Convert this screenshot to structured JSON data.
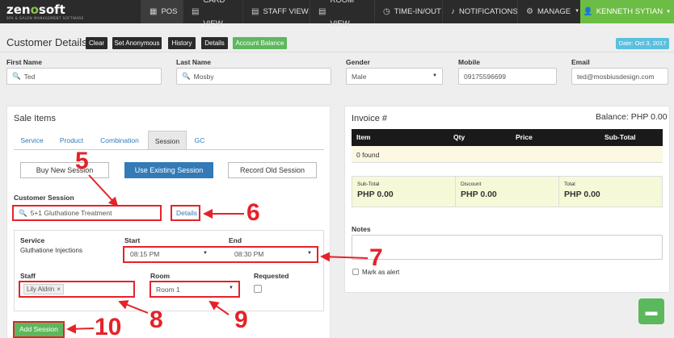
{
  "nav": {
    "logo_main_a": "zen",
    "logo_main_o": "o",
    "logo_main_b": "soft",
    "logo_sub": "SPA & SALON MANAGEMENT SOFTWARE",
    "items": [
      {
        "label": "POS",
        "icon": "grid-icon"
      },
      {
        "label": "CARD VIEW",
        "icon": "cards-icon"
      },
      {
        "label": "STAFF VIEW",
        "icon": "staff-icon"
      },
      {
        "label": "ROOM VIEW",
        "icon": "room-icon"
      },
      {
        "label": "TIME-IN/OUT",
        "icon": "clock-icon"
      },
      {
        "label": "NOTIFICATIONS",
        "icon": "bell-icon"
      },
      {
        "label": "MANAGE",
        "icon": "gear-icon"
      }
    ],
    "user": "KENNETH SYTIAN"
  },
  "customer": {
    "title": "Customer Details",
    "buttons": {
      "clear": "Clear",
      "set_anonymous": "Set Anonymous",
      "history": "History",
      "details": "Details",
      "account_balance": "Account Balance"
    },
    "date": "Date: Oct 3, 2017",
    "labels": {
      "first_name": "First Name",
      "last_name": "Last Name",
      "gender": "Gender",
      "mobile": "Mobile",
      "email": "Email"
    },
    "values": {
      "first_name": "Ted",
      "last_name": "Mosby",
      "gender": "Male",
      "mobile": "09175596699",
      "email": "ted@mosbiusdesign.com"
    }
  },
  "sale": {
    "title": "Sale Items",
    "tabs": [
      "Service",
      "Product",
      "Combination",
      "Session",
      "GC"
    ],
    "buttons": {
      "buy_new": "Buy New Session",
      "use_existing": "Use Existing Session",
      "record_old": "Record Old Session"
    },
    "customer_session_label": "Customer Session",
    "customer_session_value": "5+1 Gluthatione Treatment",
    "details_link": "Details",
    "service_label": "Service",
    "service_value": "Gluthatione Injections",
    "start_label": "Start",
    "start_value": "08:15 PM",
    "end_label": "End",
    "end_value": "08:30 PM",
    "staff_label": "Staff",
    "staff_tag": "Lily Aldrin",
    "room_label": "Room",
    "room_value": "Room 1",
    "requested_label": "Requested",
    "add_session": "Add Session"
  },
  "invoice": {
    "title": "Invoice #",
    "balance": "Balance: PHP 0.00",
    "headers": {
      "item": "Item",
      "qty": "Qty",
      "price": "Price",
      "subtotal": "Sub-Total"
    },
    "empty": "0 found",
    "totals": [
      {
        "label": "Sub-Total",
        "value": "PHP 0.00"
      },
      {
        "label": "Discount",
        "value": "PHP 0.00"
      },
      {
        "label": "Total",
        "value": "PHP 0.00"
      }
    ],
    "notes_label": "Notes",
    "alert_label": "Mark as alert"
  },
  "annotations": {
    "n5": "5",
    "n6": "6",
    "n7": "7",
    "n8": "8",
    "n9": "9",
    "n10": "10"
  },
  "colors": {
    "nav_bg": "#2b2b2b",
    "user_bg": "#6cbd45",
    "primary": "#337ab7",
    "success": "#5cb85c",
    "info": "#5bc0de",
    "annotation": "#e52229"
  }
}
